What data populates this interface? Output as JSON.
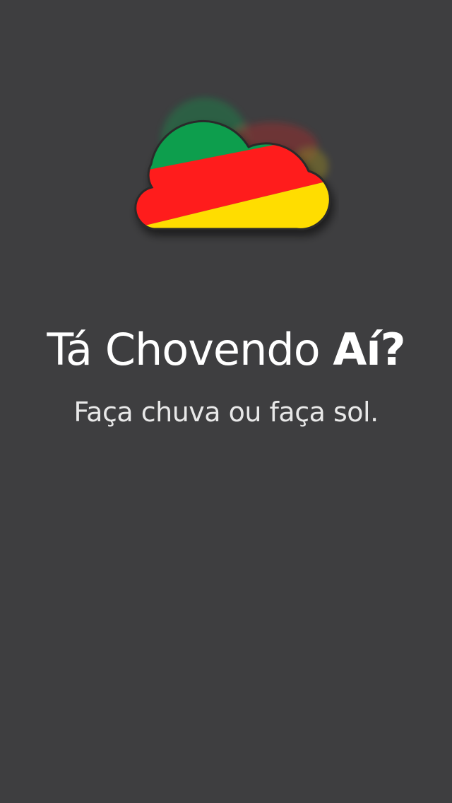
{
  "splash": {
    "logo": {
      "icon": "cloud-icon",
      "colors": {
        "green": "#0a9e4e",
        "red": "#ff1b1b",
        "yellow": "#ffdd00",
        "outline": "#2a2a2a"
      }
    },
    "title_regular": "Tá Chovendo ",
    "title_bold": "Aí?",
    "subtitle": "Faça chuva ou faça sol.",
    "background": "#3e3e40"
  }
}
